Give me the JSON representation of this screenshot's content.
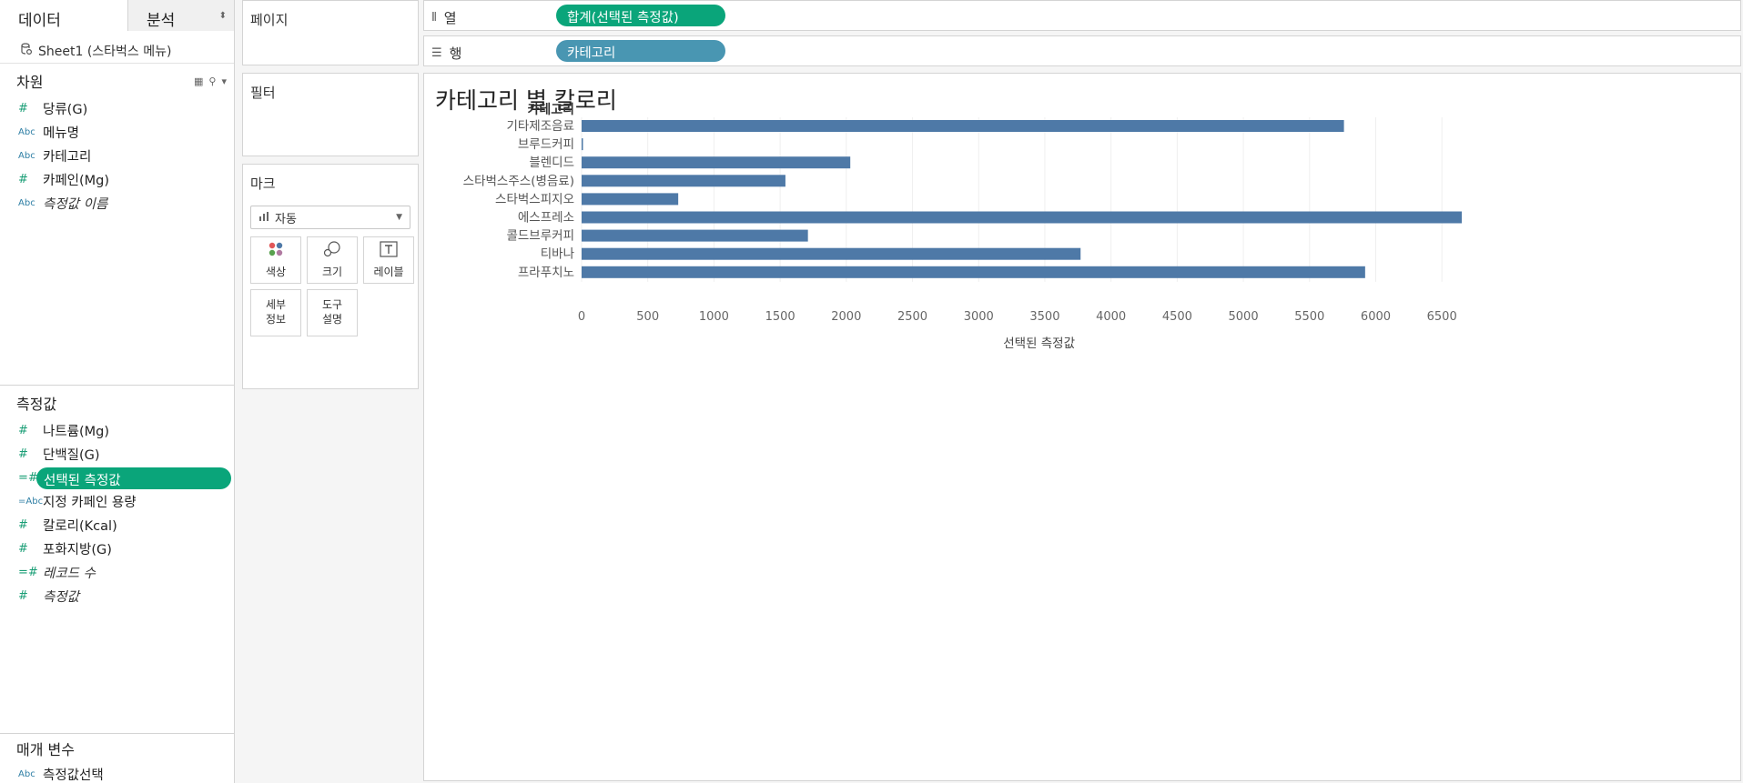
{
  "tabs": {
    "data": "데이터",
    "analysis": "분석"
  },
  "source": {
    "name": "Sheet1 (스타벅스 메뉴)"
  },
  "dimensions": {
    "title": "차원",
    "fields": [
      {
        "type": "#",
        "name": "당류(G)",
        "italic": false
      },
      {
        "type": "Abc",
        "name": "메뉴명",
        "italic": false
      },
      {
        "type": "Abc",
        "name": "카테고리",
        "italic": false
      },
      {
        "type": "#",
        "name": "카페인(Mg)",
        "italic": false
      },
      {
        "type": "Abc",
        "name": "측정값 이름",
        "italic": true
      }
    ]
  },
  "measures": {
    "title": "측정값",
    "fields": [
      {
        "type": "#",
        "name": "나트륨(Mg)",
        "italic": false
      },
      {
        "type": "#",
        "name": "단백질(G)",
        "italic": false
      },
      {
        "type": "=#",
        "name": "선택된 측정값",
        "italic": false,
        "selected": true
      },
      {
        "type": "=Abc",
        "name": "지정 카페인 용량",
        "italic": false
      },
      {
        "type": "#",
        "name": "칼로리(Kcal)",
        "italic": false
      },
      {
        "type": "#",
        "name": "포화지방(G)",
        "italic": false
      },
      {
        "type": "=#",
        "name": "레코드 수",
        "italic": true
      },
      {
        "type": "#",
        "name": "측정값",
        "italic": true
      }
    ]
  },
  "parameters": {
    "title": "매개 변수",
    "fields": [
      {
        "type": "Abc",
        "name": "측정값선택",
        "italic": false
      }
    ]
  },
  "shelves": {
    "pages": "페이지",
    "filters": "필터",
    "marks": "마크",
    "mark_type": "자동",
    "mark_buttons": [
      "색상",
      "크기",
      "레이블",
      "세부\n정보",
      "도구\n설명"
    ],
    "columns_label": "열",
    "rows_label": "행",
    "columns_pill": "합계(선택된 측정값)",
    "rows_pill": "카테고리"
  },
  "colors": {
    "measure_pill": "#0aa57a",
    "dimension_pill": "#4996b2",
    "bar": "#4e79a7"
  },
  "chart_data": {
    "type": "bar",
    "orientation": "horizontal",
    "title": "카테고리 별 칼로리",
    "row_header": "카테고리",
    "categories": [
      "기타제조음료",
      "브루드커피",
      "블렌디드",
      "스타벅스주스(병음료)",
      "스타벅스피지오",
      "에스프레소",
      "콜드브루커피",
      "티바나",
      "프라푸치노"
    ],
    "values": [
      5760,
      10,
      2030,
      1540,
      730,
      6650,
      1710,
      3770,
      5920
    ],
    "xlabel": "선택된 측정값",
    "xticks": [
      0,
      500,
      1000,
      1500,
      2000,
      2500,
      3000,
      3500,
      4000,
      4500,
      5000,
      5500,
      6000,
      6500
    ],
    "xlim": [
      0,
      6650
    ],
    "grid": true
  }
}
